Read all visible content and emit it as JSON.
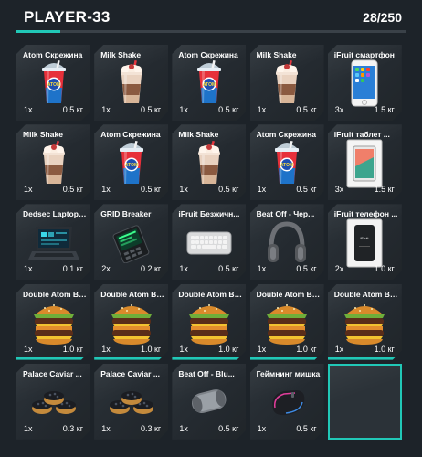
{
  "header": {
    "title": "PLAYER-33",
    "capacity": "28/250",
    "fill_fraction": 0.112
  },
  "colors": {
    "accent": "#21c8b7",
    "background": "#1d2329",
    "slot": "#2a3036"
  },
  "slots": [
    {
      "name": "Atom Скрежина",
      "qty": "1x",
      "weight": "0.5 кг",
      "icon": "slush-cup-icon"
    },
    {
      "name": "Milk Shake",
      "qty": "1x",
      "weight": "0.5 кг",
      "icon": "milkshake-icon"
    },
    {
      "name": "Atom Скрежина",
      "qty": "1x",
      "weight": "0.5 кг",
      "icon": "slush-cup-icon"
    },
    {
      "name": "Milk Shake",
      "qty": "1x",
      "weight": "0.5 кг",
      "icon": "milkshake-icon"
    },
    {
      "name": "iFruit смартфон",
      "qty": "3x",
      "weight": "1.5 кг",
      "icon": "smartphone-icon"
    },
    {
      "name": "Milk Shake",
      "qty": "1x",
      "weight": "0.5 кг",
      "icon": "milkshake-icon"
    },
    {
      "name": "Atom Скрежина",
      "qty": "1x",
      "weight": "0.5 кг",
      "icon": "slush-cup-icon"
    },
    {
      "name": "Milk Shake",
      "qty": "1x",
      "weight": "0.5 кг",
      "icon": "milkshake-icon"
    },
    {
      "name": "Atom Скрежина",
      "qty": "1x",
      "weight": "0.5 кг",
      "icon": "slush-cup-icon"
    },
    {
      "name": "iFruit таблет ...",
      "qty": "3x",
      "weight": "1.5 кг",
      "icon": "tablet-box-icon"
    },
    {
      "name": "Dedsec Laptop ...",
      "qty": "1x",
      "weight": "0.1 кг",
      "icon": "laptop-icon"
    },
    {
      "name": "GRID Breaker",
      "qty": "2x",
      "weight": "0.2 кг",
      "icon": "hacking-device-icon"
    },
    {
      "name": "iFruit Безжичн...",
      "qty": "1x",
      "weight": "0.5 кг",
      "icon": "keyboard-icon"
    },
    {
      "name": "Beat Off - Чер...",
      "qty": "1x",
      "weight": "0.5 кг",
      "icon": "headphones-icon"
    },
    {
      "name": "iFruit телефон ...",
      "qty": "2x",
      "weight": "1.0 кг",
      "icon": "phone-box-icon"
    },
    {
      "name": "Double Atom Bu...",
      "qty": "1x",
      "weight": "1.0 кг",
      "icon": "burger-icon"
    },
    {
      "name": "Double Atom Bu...",
      "qty": "1x",
      "weight": "1.0 кг",
      "icon": "burger-icon"
    },
    {
      "name": "Double Atom Bu...",
      "qty": "1x",
      "weight": "1.0 кг",
      "icon": "burger-icon"
    },
    {
      "name": "Double Atom Bu...",
      "qty": "1x",
      "weight": "1.0 кг",
      "icon": "burger-icon"
    },
    {
      "name": "Double Atom Bu...",
      "qty": "1x",
      "weight": "1.0 кг",
      "icon": "burger-icon"
    },
    {
      "name": "Palace Caviar ...",
      "qty": "1x",
      "weight": "0.3 кг",
      "icon": "caviar-icon"
    },
    {
      "name": "Palace Caviar ...",
      "qty": "1x",
      "weight": "0.3 кг",
      "icon": "caviar-icon"
    },
    {
      "name": "Beat Off - Blu...",
      "qty": "1x",
      "weight": "0.5 кг",
      "icon": "speaker-icon"
    },
    {
      "name": "Геймнинг мишка",
      "qty": "1x",
      "weight": "0.5 кг",
      "icon": "gaming-mouse-icon"
    },
    {
      "name": "",
      "qty": "",
      "weight": "",
      "icon": ""
    }
  ]
}
